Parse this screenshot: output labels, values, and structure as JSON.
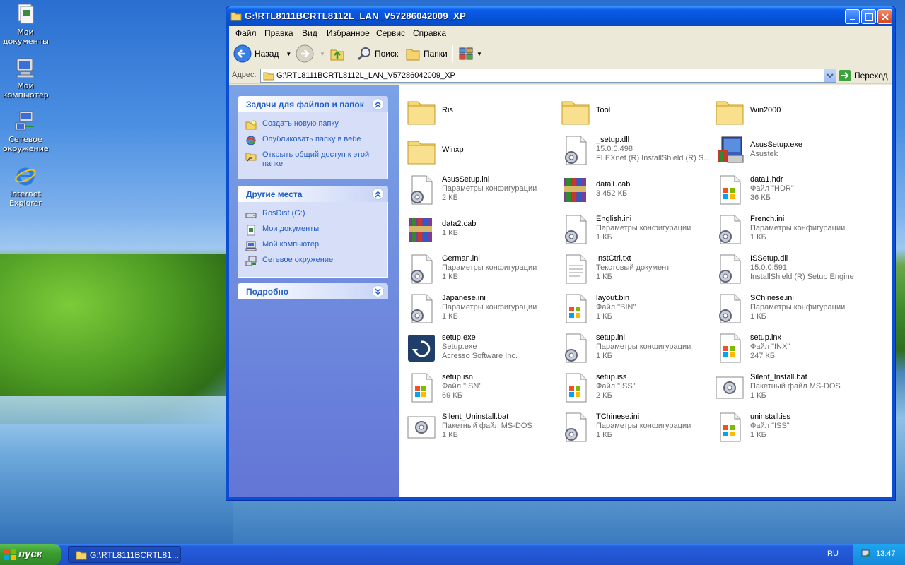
{
  "desktop": {
    "icons": [
      {
        "label": "Мои документы"
      },
      {
        "label": "Мой компьютер"
      },
      {
        "label": "Сетевое окружение"
      },
      {
        "label": "Internet Explorer"
      }
    ]
  },
  "window": {
    "title": "G:\\RTL8111BCRTL8112L_LAN_V57286042009_XP",
    "menu": [
      "Файл",
      "Правка",
      "Вид",
      "Избранное",
      "Сервис",
      "Справка"
    ],
    "toolbar": {
      "back": "Назад",
      "search": "Поиск",
      "folders": "Папки"
    },
    "address": {
      "label": "Адрес:",
      "value": "G:\\RTL8111BCRTL8112L_LAN_V57286042009_XP",
      "go": "Переход"
    }
  },
  "taskpane": {
    "tasks": {
      "title": "Задачи для файлов и папок",
      "items": [
        {
          "label": "Создать новую папку",
          "icon": "new-folder-icon"
        },
        {
          "label": "Опубликовать папку в вебе",
          "icon": "publish-web-icon"
        },
        {
          "label": "Открыть общий доступ к этой папке",
          "icon": "share-folder-icon"
        }
      ]
    },
    "places": {
      "title": "Другие места",
      "items": [
        {
          "label": "RosDist (G:)",
          "icon": "drive-icon"
        },
        {
          "label": "Мои документы",
          "icon": "my-documents-icon"
        },
        {
          "label": "Мой компьютер",
          "icon": "my-computer-icon"
        },
        {
          "label": "Сетевое окружение",
          "icon": "network-icon"
        }
      ]
    },
    "details": {
      "title": "Подробно"
    }
  },
  "files": [
    {
      "name": "Ris",
      "line2": "",
      "line3": "",
      "icon": "folder"
    },
    {
      "name": "Tool",
      "line2": "",
      "line3": "",
      "icon": "folder"
    },
    {
      "name": "Win2000",
      "line2": "",
      "line3": "",
      "icon": "folder"
    },
    {
      "name": "Winxp",
      "line2": "",
      "line3": "",
      "icon": "folder"
    },
    {
      "name": "_setup.dll",
      "line2": "15.0.0.498",
      "line3": "FLEXnet (R) InstallShield (R) S...",
      "icon": "dll"
    },
    {
      "name": "AsusSetup.exe",
      "line2": "Asustek",
      "line3": "",
      "icon": "setup-exe"
    },
    {
      "name": "AsusSetup.ini",
      "line2": "Параметры конфигурации",
      "line3": "2 КБ",
      "icon": "ini"
    },
    {
      "name": "data1.cab",
      "line2": "3 452 КБ",
      "line3": "",
      "icon": "cab"
    },
    {
      "name": "data1.hdr",
      "line2": "Файл \"HDR\"",
      "line3": "36 КБ",
      "icon": "generic"
    },
    {
      "name": "data2.cab",
      "line2": "1 КБ",
      "line3": "",
      "icon": "cab"
    },
    {
      "name": "English.ini",
      "line2": "Параметры конфигурации",
      "line3": "1 КБ",
      "icon": "ini"
    },
    {
      "name": "French.ini",
      "line2": "Параметры конфигурации",
      "line3": "1 КБ",
      "icon": "ini"
    },
    {
      "name": "German.ini",
      "line2": "Параметры конфигурации",
      "line3": "1 КБ",
      "icon": "ini"
    },
    {
      "name": "InstCtrl.txt",
      "line2": "Текстовый документ",
      "line3": "1 КБ",
      "icon": "txt"
    },
    {
      "name": "ISSetup.dll",
      "line2": "15.0.0.591",
      "line3": "InstallShield (R) Setup Engine",
      "icon": "dll"
    },
    {
      "name": "Japanese.ini",
      "line2": "Параметры конфигурации",
      "line3": "1 КБ",
      "icon": "ini"
    },
    {
      "name": "layout.bin",
      "line2": "Файл \"BIN\"",
      "line3": "1 КБ",
      "icon": "generic"
    },
    {
      "name": "SChinese.ini",
      "line2": "Параметры конфигурации",
      "line3": "1 КБ",
      "icon": "ini"
    },
    {
      "name": "setup.exe",
      "line2": "Setup.exe",
      "line3": "Acresso Software Inc.",
      "icon": "installer"
    },
    {
      "name": "setup.ini",
      "line2": "Параметры конфигурации",
      "line3": "1 КБ",
      "icon": "ini"
    },
    {
      "name": "setup.inx",
      "line2": "Файл \"INX\"",
      "line3": "247 КБ",
      "icon": "generic"
    },
    {
      "name": "setup.isn",
      "line2": "Файл \"ISN\"",
      "line3": "69 КБ",
      "icon": "generic"
    },
    {
      "name": "setup.iss",
      "line2": "Файл \"ISS\"",
      "line3": "2 КБ",
      "icon": "generic"
    },
    {
      "name": "Silent_Install.bat",
      "line2": "Пакетный файл MS-DOS",
      "line3": "1 КБ",
      "icon": "bat"
    },
    {
      "name": "Silent_Uninstall.bat",
      "line2": "Пакетный файл MS-DOS",
      "line3": "1 КБ",
      "icon": "bat"
    },
    {
      "name": "TChinese.ini",
      "line2": "Параметры конфигурации",
      "line3": "1 КБ",
      "icon": "ini"
    },
    {
      "name": "uninstall.iss",
      "line2": "Файл \"ISS\"",
      "line3": "1 КБ",
      "icon": "generic"
    }
  ],
  "taskbar": {
    "start": "пуск",
    "task": "G:\\RTL8111BCRTL81...",
    "lang": "RU",
    "clock": "13:47"
  }
}
